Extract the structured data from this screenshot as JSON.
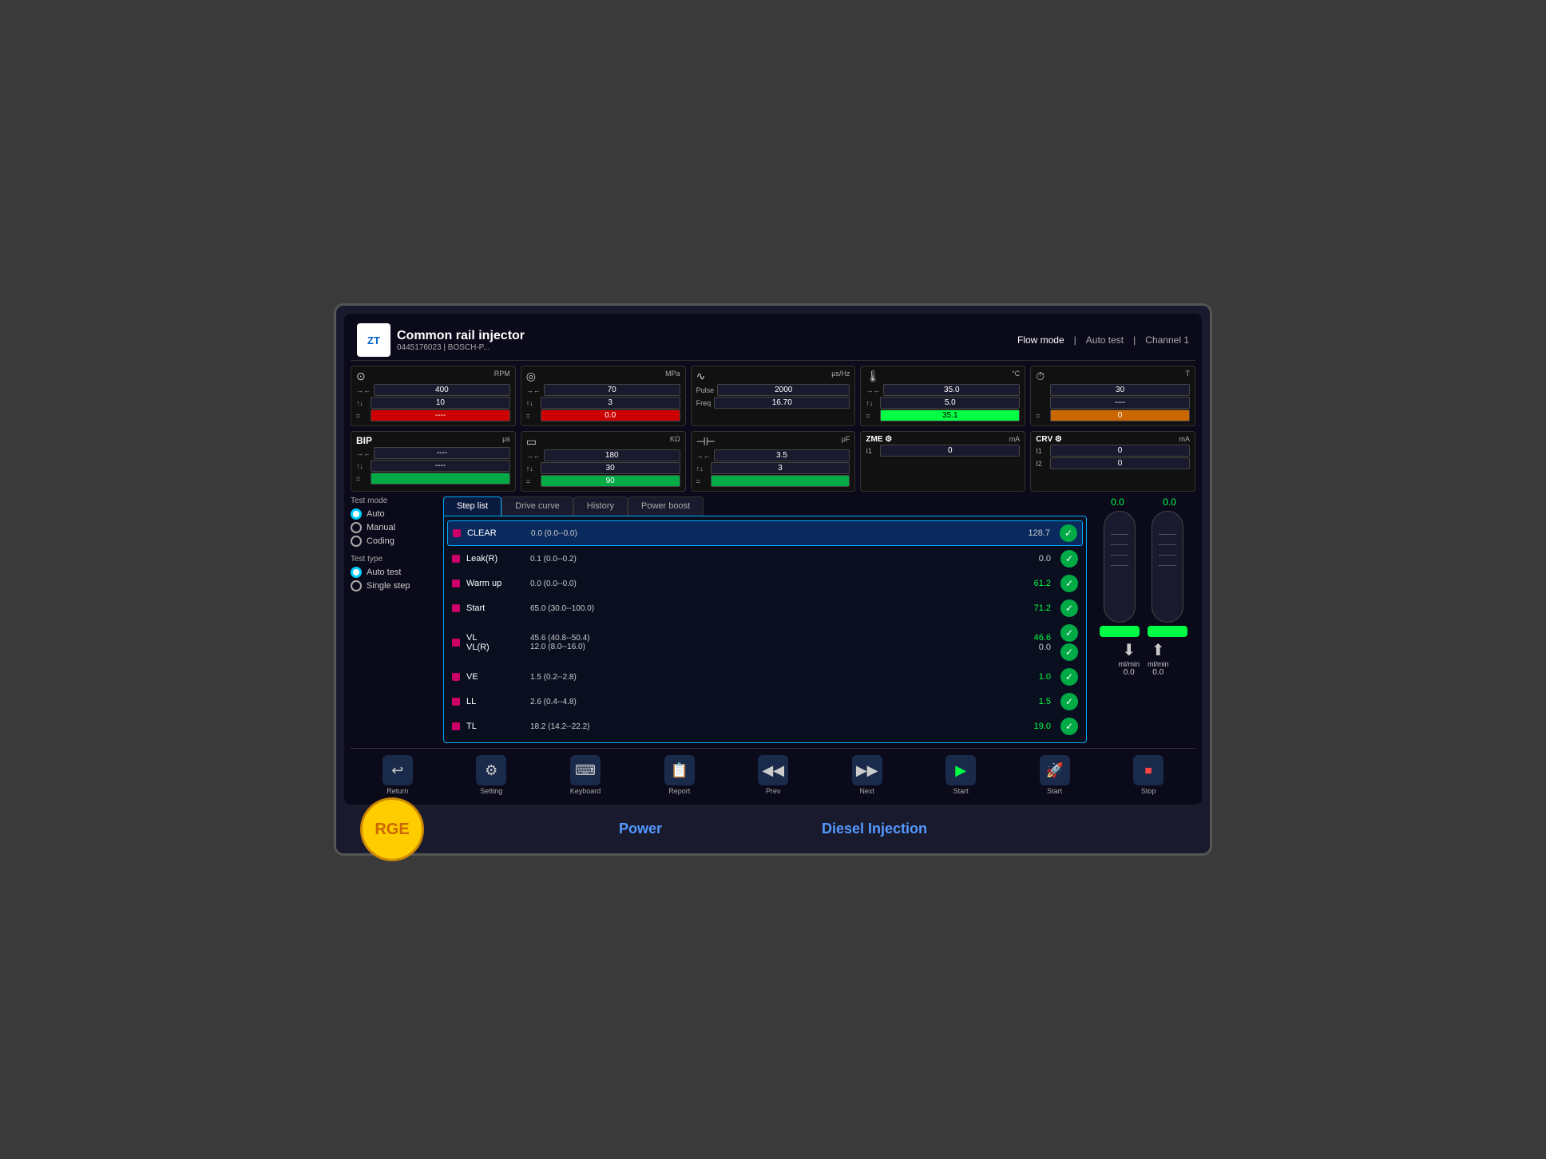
{
  "header": {
    "logo": "ZT",
    "title": "Common rail injector",
    "subtitle": "0445176023 | BOSCH-P...",
    "mode": "Flow mode",
    "test": "Auto test",
    "channel": "Channel 1"
  },
  "gauges_row1": [
    {
      "icon": "⊙",
      "unit": "RPM",
      "rows": [
        {
          "arrow": "→ ←",
          "value": "400"
        },
        {
          "arrow": "↑↓",
          "value": "10"
        },
        {
          "arrow": "=",
          "value": "----",
          "style": "red"
        }
      ]
    },
    {
      "icon": "◎",
      "unit": "MPa",
      "rows": [
        {
          "arrow": "→ ←",
          "value": "70"
        },
        {
          "arrow": "↑↓",
          "value": "3"
        },
        {
          "arrow": "=",
          "value": "0.0",
          "style": "red"
        }
      ]
    },
    {
      "icon": "∿",
      "unit": "μs/Hz",
      "rows": [
        {
          "arrow": "Pulse",
          "value": "2000"
        },
        {
          "arrow": "Freq",
          "value": "16.70"
        },
        {
          "arrow": "",
          "value": ""
        }
      ]
    },
    {
      "icon": "🌡",
      "unit": "°C",
      "rows": [
        {
          "arrow": "→ ←",
          "value": "35.0"
        },
        {
          "arrow": "↑↓",
          "value": "5.0"
        },
        {
          "arrow": "=",
          "value": "35.1",
          "style": "green-bright"
        }
      ]
    },
    {
      "icon": "⏱",
      "unit": "T",
      "rows": [
        {
          "arrow": "",
          "value": "30"
        },
        {
          "arrow": "",
          "value": "----"
        },
        {
          "arrow": "=",
          "value": "0",
          "style": "orange"
        }
      ]
    }
  ],
  "gauges_row2": [
    {
      "label": "BIP",
      "unit": "μs",
      "rows": [
        {
          "arrow": "→ ←",
          "value": "----"
        },
        {
          "arrow": "↑↓",
          "value": "----"
        },
        {
          "arrow": "=",
          "value": "",
          "style": "green"
        }
      ]
    },
    {
      "label": "",
      "unit": "KΩ",
      "rows": [
        {
          "arrow": "→ ←",
          "value": "180"
        },
        {
          "arrow": "↑↓",
          "value": "30"
        },
        {
          "arrow": "=",
          "value": "90",
          "style": "green"
        }
      ]
    },
    {
      "label": "",
      "unit": "μF",
      "rows": [
        {
          "arrow": "→ ←",
          "value": "3.5"
        },
        {
          "arrow": "↑↓",
          "value": "3"
        },
        {
          "arrow": "=",
          "value": "",
          "style": "green"
        }
      ]
    },
    {
      "label": "ZME",
      "unit": "mA",
      "rows": [
        {
          "arrow": "I1",
          "value": "0"
        }
      ]
    },
    {
      "label": "CRV",
      "unit": "mA",
      "rows": [
        {
          "arrow": "I1",
          "value": "0"
        },
        {
          "arrow": "I2",
          "value": "0"
        }
      ]
    }
  ],
  "sidebar": {
    "test_mode_label": "Test mode",
    "test_modes": [
      {
        "label": "Auto",
        "checked": true
      },
      {
        "label": "Manual",
        "checked": false
      },
      {
        "label": "Coding",
        "checked": false
      }
    ],
    "test_type_label": "Test type",
    "test_types": [
      {
        "label": "Auto test",
        "checked": true
      },
      {
        "label": "Single step",
        "checked": false
      }
    ]
  },
  "tabs": [
    {
      "label": "Step list",
      "active": true
    },
    {
      "label": "Drive curve",
      "active": false
    },
    {
      "label": "History",
      "active": false
    },
    {
      "label": "Power boost",
      "active": false
    }
  ],
  "steps": [
    {
      "name": "CLEAR",
      "range": "0.0 (0.0--0.0)",
      "value": "128.7",
      "checked": true,
      "selected": true,
      "value_color": "normal"
    },
    {
      "name": "Leak(R)",
      "range": "0.1 (0.0--0.2)",
      "value": "0.0",
      "checked": true,
      "selected": false,
      "value_color": "normal"
    },
    {
      "name": "Warm up",
      "range": "0.0 (0.0--0.0)",
      "value": "61.2",
      "checked": true,
      "selected": false,
      "value_color": "green"
    },
    {
      "name": "Start",
      "range": "65.0 (30.0--100.0)",
      "value": "71.2",
      "checked": true,
      "selected": false,
      "value_color": "green"
    },
    {
      "name": "VL",
      "range": "45.6 (40.8--50.4)",
      "value": "46.6",
      "checked": true,
      "selected": false,
      "value_color": "green"
    },
    {
      "name": "VL(R)",
      "range": "12.0 (8.0--16.0)",
      "value": "0.0",
      "checked": true,
      "selected": false,
      "value_color": "normal"
    },
    {
      "name": "VE",
      "range": "1.5 (0.2--2.8)",
      "value": "1.0",
      "checked": true,
      "selected": false,
      "value_color": "green"
    },
    {
      "name": "LL",
      "range": "2.6 (0.4--4.8)",
      "value": "1.5",
      "checked": true,
      "selected": false,
      "value_color": "green"
    },
    {
      "name": "TL",
      "range": "18.2 (14.2--22.2)",
      "value": "19.0",
      "checked": true,
      "selected": false,
      "value_color": "green"
    }
  ],
  "meters": {
    "left_value": "0.0",
    "right_value": "0.0",
    "left_bottom": "0.0",
    "right_bottom": "0.0",
    "unit": "ml/min"
  },
  "toolbar": [
    {
      "icon": "↩",
      "label": "Return"
    },
    {
      "icon": "⚙",
      "label": "Setting"
    },
    {
      "icon": "⌨",
      "label": "Keyboard"
    },
    {
      "icon": "📋",
      "label": "Report"
    },
    {
      "icon": "◀",
      "label": "Prev"
    },
    {
      "icon": "▶",
      "label": "Next"
    },
    {
      "icon": "▶",
      "label": "Start"
    },
    {
      "icon": "⏺",
      "label": "Start"
    },
    {
      "icon": "⏹",
      "label": "Stop"
    }
  ],
  "bottom_labels": [
    "Power",
    "Diesel Injection"
  ]
}
